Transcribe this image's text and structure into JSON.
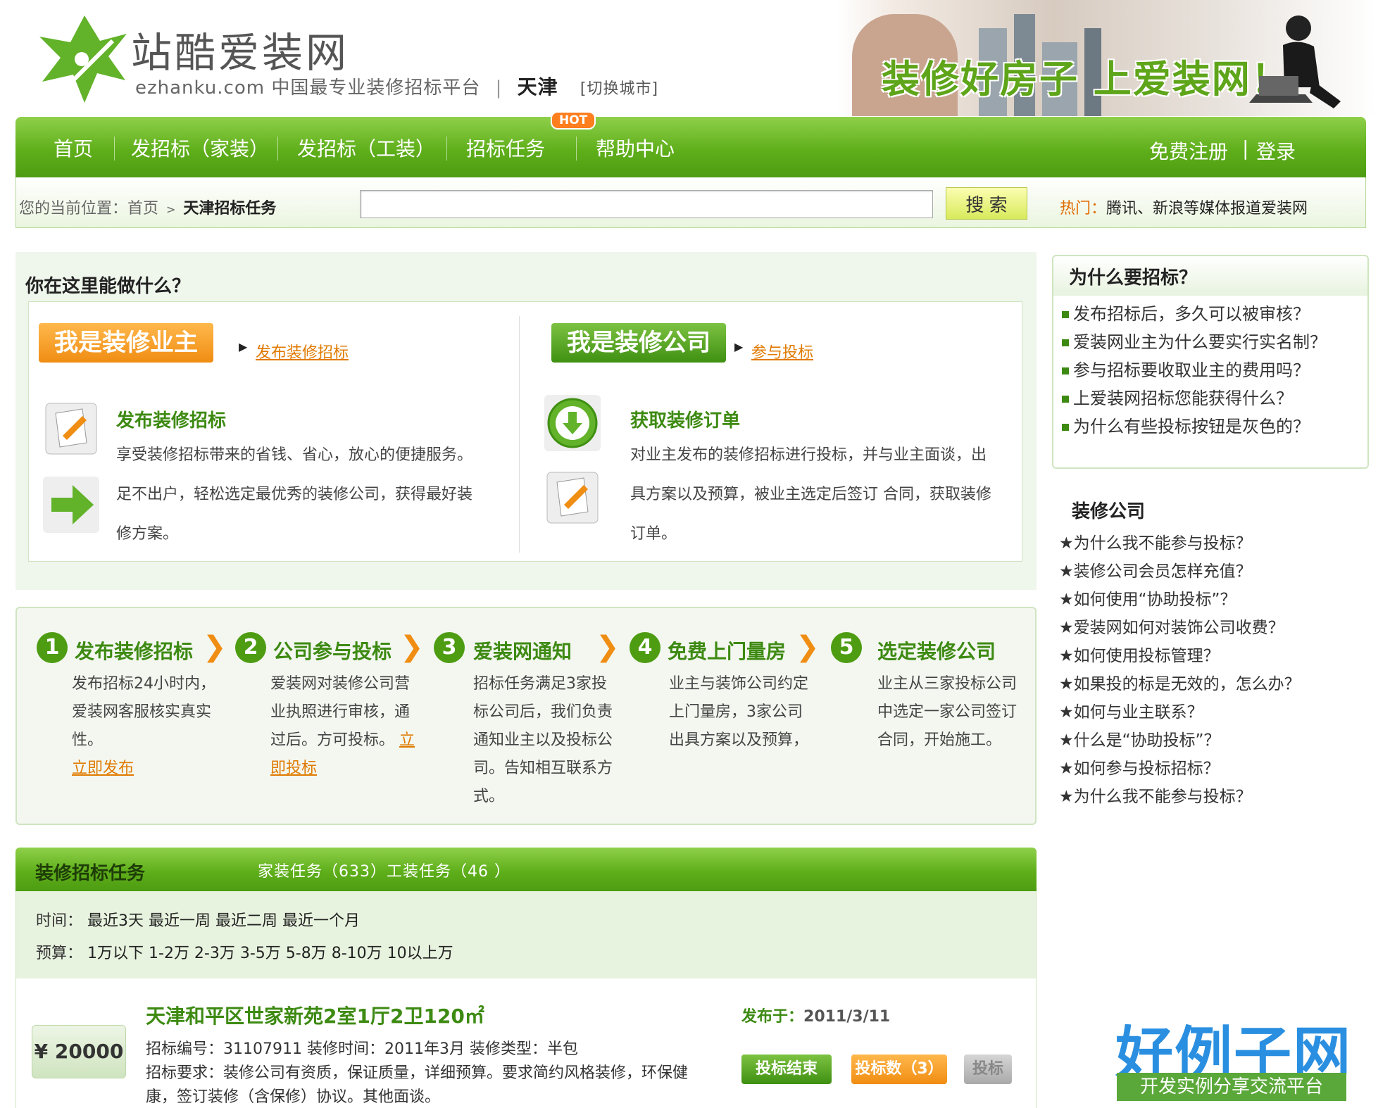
{
  "header": {
    "logo_title": "站酷爱装网",
    "logo_domain": "ezhanku.com",
    "tagline": "中国最专业装修招标平台",
    "separator": "|",
    "city": "天津",
    "city_switch": "[切换城市]",
    "banner_slogan": "装修好房子 上爱装网！"
  },
  "nav": {
    "items": [
      "首页",
      "发招标（家装）",
      "发招标（工装）",
      "招标任务",
      "帮助中心"
    ],
    "hot_badge": "HOT",
    "register": "免费注册",
    "sep": "|",
    "login": "登录"
  },
  "search": {
    "breadcrumb_prefix": "您的当前位置：首页",
    "breadcrumb_arrow": ">",
    "breadcrumb_current": "天津招标任务",
    "input_value": "",
    "button": "搜 索",
    "hot_label": "热门：",
    "hot_text": "腾讯、新浪等媒体报道爱装网"
  },
  "what": {
    "title": "你在这里能做什么？",
    "owner_button": "我是装修业主",
    "owner_link": "发布装修招标",
    "company_button": "我是装修公司",
    "company_link": "参与投标",
    "owner_feature_title": "发布装修招标",
    "owner_feature_text1": "享受装修招标带来的省钱、省心，放心的便捷服务。",
    "owner_feature_text2": "足不出户，轻松选定最优秀的装修公司，获得最好装",
    "owner_feature_text3": "修方案。",
    "company_feature_title": "获取装修订单",
    "company_feature_text1": "对业主发布的装修招标进行投标，并与业主面谈，出",
    "company_feature_text2": "具方案以及预算，被业主选定后签订 合同，获取装修",
    "company_feature_text3": "订单。"
  },
  "steps": [
    {
      "num": "1",
      "title": "发布装修招标",
      "text": "发布招标24小时内，爱装网客服核实真实性。",
      "link": "立即发布"
    },
    {
      "num": "2",
      "title": "公司参与投标",
      "text": "爱装网对装修公司营业执照进行审核，通过后。方可投标。",
      "link": "立即投标"
    },
    {
      "num": "3",
      "title": "爱装网通知",
      "text": "招标任务满足3家投标公司后，我们负责通知业主以及投标公司。告知相互联系方式。",
      "link": ""
    },
    {
      "num": "4",
      "title": "免费上门量房",
      "text": "业主与装饰公司约定上门量房，3家公司出具方案以及预算，",
      "link": ""
    },
    {
      "num": "5",
      "title": "选定装修公司",
      "text": "业主从三家投标公司中选定一家公司签订合同，开始施工。",
      "link": ""
    }
  ],
  "tasks": {
    "title": "装修招标任务",
    "tabs": "家装任务（633）工装任务（46 ）",
    "time_label": "时间：",
    "time_options": "最近3天 最近一周 最近二周 最近一个月",
    "budget_label": "预算：",
    "budget_options": "1万以下 1-2万 2-3万 3-5万 5-8万 8-10万 10以上万",
    "item": {
      "price": "¥ 20000",
      "title": "天津和平区世家新苑2室1厅2卫120㎡",
      "date_label": "发布于：",
      "date": "2011/3/11",
      "line1": "招标编号：31107911  装修时间：2011年3月  装修类型：半包",
      "line2": "招标要求：装修公司有资质，保证质量，详细预算。要求简约风格装修，环保健",
      "line3": "康，签订装修（含保修）协议。其他面谈。",
      "btn_end": "投标结束",
      "btn_count": "投标数（3）",
      "btn_bid": "投标"
    }
  },
  "sidebar": {
    "why_title": "为什么要招标？",
    "why_items": [
      "发布招标后，多久可以被审核？",
      "爱装网业主为什么要实行实名制？",
      "参与招标要收取业主的费用吗？",
      "上爱装网招标您能获得什么？",
      "为什么有些投标按钮是灰色的？"
    ],
    "company_title": "装修公司",
    "company_items": [
      "★为什么我不能参与投标？",
      "★装修公司会员怎样充值？",
      "★如何使用“协助投标”？",
      "★爱装网如何对装饰公司收费？",
      "★如何使用投标管理？",
      "★如果投的标是无效的，怎么办？",
      "★如何与业主联系？",
      "★什么是“协助投标”？",
      "★如何参与投标招标？",
      "★为什么我不能参与投标？"
    ]
  },
  "watermark": {
    "title": "好例子网",
    "subtitle": "开发实例分享交流平台"
  },
  "colors": {
    "brand_green": "#5faf1b",
    "accent_orange": "#f08d13",
    "link_orange": "#e07a00"
  }
}
